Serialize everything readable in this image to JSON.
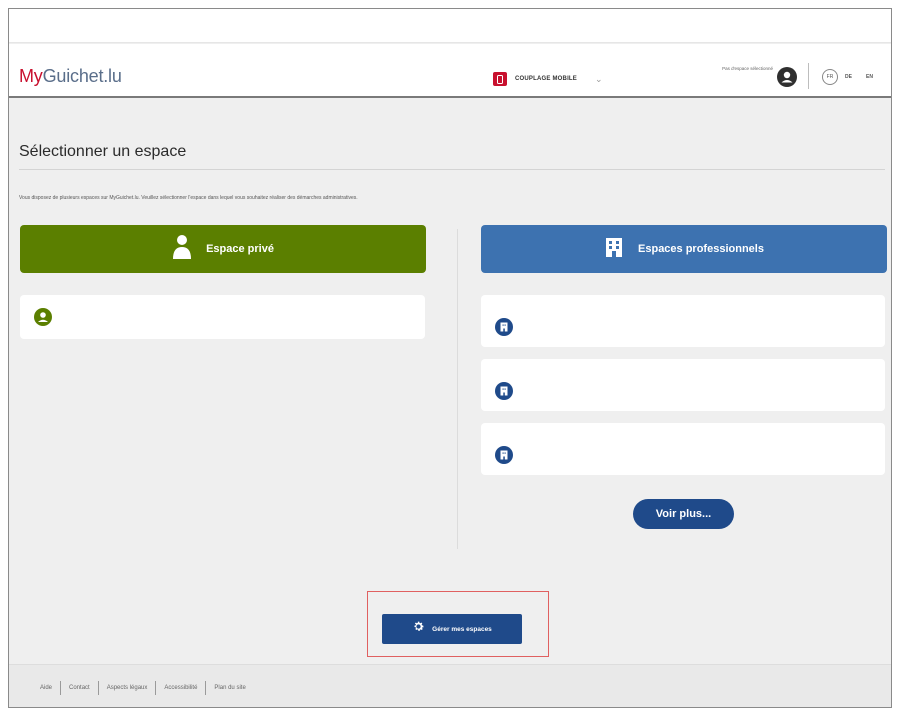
{
  "header": {
    "logo_my": "My",
    "logo_rest": "Guichet.lu",
    "mobile_label": "COUPLAGE MOBILE",
    "no_space_label": "Pas d'espace sélectionné",
    "languages": [
      "FR",
      "DE",
      "EN"
    ]
  },
  "main": {
    "title": "Sélectionner un espace",
    "intro": "Vous disposez de plusieurs espaces sur MyGuichet.lu. Veuillez sélectionner l'espace dans lequel vous souhaitez réaliser des démarches administratives.",
    "private_button": "Espace privé",
    "pro_button": "Espaces professionnels",
    "more_button": "Voir plus...",
    "manage_button": "Gérer mes espaces"
  },
  "footer": {
    "links": [
      "Aide",
      "Contact",
      "Aspects légaux",
      "Accessibilité",
      "Plan du site"
    ]
  },
  "colors": {
    "brand_red": "#c8102e",
    "private_green": "#5b7f00",
    "pro_blue": "#3d72b0",
    "navy": "#1f4a8a"
  }
}
